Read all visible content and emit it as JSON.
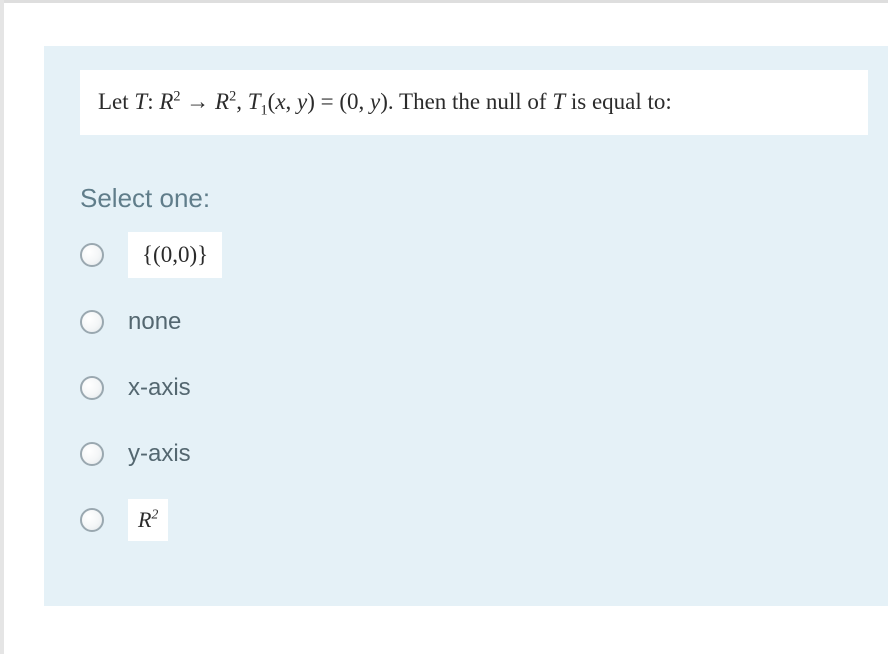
{
  "question": {
    "stem_prefix": "Let  ",
    "stem_math_html": "<span class='ital'>T</span>: <span class='ital'>R</span><span class='sup'>2</span> → <span class='ital'>R</span><span class='sup'>2</span>,  <span class='ital'>T</span><span class='sub'>1</span>(<span class='ital'>x</span>, <span class='ital'>y</span>) = (0, <span class='ital'>y</span>).",
    "stem_suffix": "  Then the null of ",
    "stem_T": "T",
    "stem_end": "  is equal to:"
  },
  "select_label": "Select one:",
  "options": [
    {
      "id": "opt1",
      "label": "{(0,0)}",
      "boxed": true
    },
    {
      "id": "opt2",
      "label": "none",
      "boxed": false
    },
    {
      "id": "opt3",
      "label": "x-axis",
      "boxed": false
    },
    {
      "id": "opt4",
      "label": "y-axis",
      "boxed": false
    },
    {
      "id": "opt5",
      "label_html": "<span class='ital'>R</span><span class='sup'>2</span>",
      "r2": true
    }
  ]
}
